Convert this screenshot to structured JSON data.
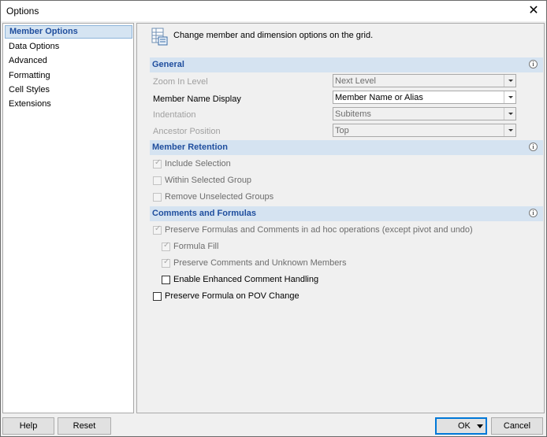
{
  "window": {
    "title": "Options",
    "close_glyph": "✕"
  },
  "sidebar": {
    "items": [
      {
        "label": "Member Options"
      },
      {
        "label": "Data Options"
      },
      {
        "label": "Advanced"
      },
      {
        "label": "Formatting"
      },
      {
        "label": "Cell Styles"
      },
      {
        "label": "Extensions"
      }
    ],
    "selected": "Member Options"
  },
  "main": {
    "hint": "Change member and dimension options on the grid.",
    "hint_icon": "grid-options-icon",
    "info_icon_glyph": "i",
    "general": {
      "title": "General",
      "rows": [
        {
          "label": "Zoom In Level",
          "value": "Next Level",
          "enabled": false
        },
        {
          "label": "Member Name Display",
          "value": "Member Name or Alias",
          "enabled": true
        },
        {
          "label": "Indentation",
          "value": "Subitems",
          "enabled": false
        },
        {
          "label": "Ancestor Position",
          "value": "Top",
          "enabled": false
        }
      ]
    },
    "member_retention": {
      "title": "Member Retention",
      "items": [
        {
          "label": "Include Selection",
          "checked": true,
          "enabled": false
        },
        {
          "label": "Within Selected Group",
          "checked": false,
          "enabled": false
        },
        {
          "label": "Remove Unselected Groups",
          "checked": false,
          "enabled": false
        }
      ]
    },
    "comments_formulas": {
      "title": "Comments and Formulas",
      "items": [
        {
          "label": "Preserve Formulas and Comments in ad hoc operations (except pivot and undo)",
          "checked": true,
          "enabled": false
        },
        {
          "label": "Formula Fill",
          "checked": true,
          "enabled": false
        },
        {
          "label": "Preserve Comments and Unknown Members",
          "checked": true,
          "enabled": false
        },
        {
          "label": "Enable Enhanced Comment Handling",
          "checked": false,
          "enabled": true
        },
        {
          "label": "Preserve Formula on POV Change",
          "checked": false,
          "enabled": true
        }
      ]
    }
  },
  "footer": {
    "help_label": "Help",
    "reset_label": "Reset",
    "ok_label": "OK",
    "cancel_label": "Cancel"
  },
  "colors": {
    "accent": "#1f4e9e",
    "section_bg": "#d5e3f1",
    "selection_bg": "#d5e4f2",
    "default_button_border": "#0078d7"
  }
}
